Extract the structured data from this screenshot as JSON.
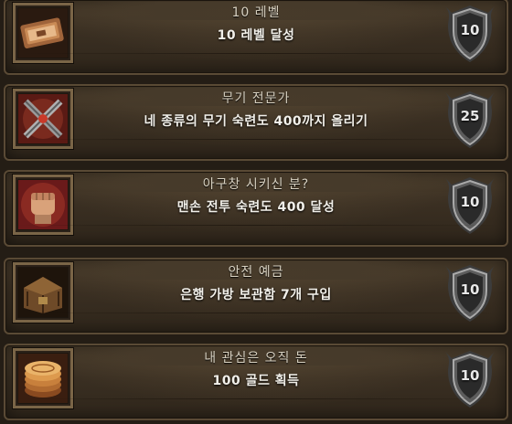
{
  "achievements": [
    {
      "title": "10 레벨",
      "description": "10 레벨 달성",
      "points": "10",
      "icon": "level-ticket-icon"
    },
    {
      "title": "무기 전문가",
      "description": "네 종류의 무기 숙련도 400까지 올리기",
      "points": "25",
      "icon": "crossed-weapons-icon"
    },
    {
      "title": "아구창 시키신 분?",
      "description": "맨손 전투 숙련도 400 달성",
      "points": "10",
      "icon": "fist-icon"
    },
    {
      "title": "안전 예금",
      "description": "은행 가방 보관함 7개 구입",
      "points": "10",
      "icon": "chest-icon"
    },
    {
      "title": "내 관심은 오직 돈",
      "description": "100 골드 획득",
      "points": "10",
      "icon": "gold-coins-icon"
    }
  ]
}
